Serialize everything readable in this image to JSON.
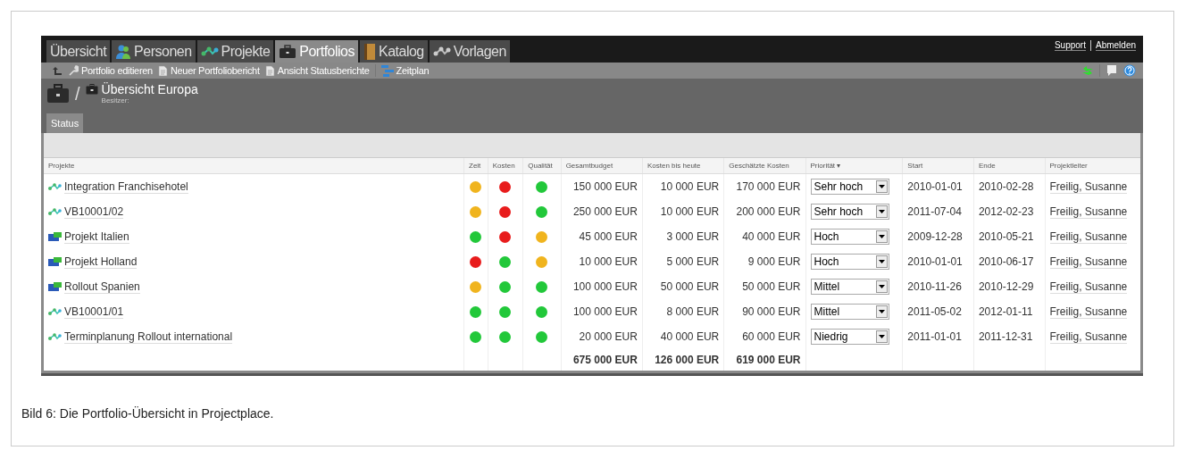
{
  "nav": {
    "tabs": [
      {
        "label": "Übersicht",
        "kind": "plain",
        "selected": false
      },
      {
        "label": "Personen",
        "kind": "people",
        "selected": false
      },
      {
        "label": "Projekte",
        "kind": "network",
        "selected": false
      },
      {
        "label": "Portfolios",
        "kind": "briefcase",
        "selected": true
      },
      {
        "label": "Katalog",
        "kind": "book",
        "selected": false
      },
      {
        "label": "Vorlagen",
        "kind": "greynetwork",
        "selected": false
      }
    ],
    "links": [
      "Support",
      "Abmelden"
    ]
  },
  "toolbar": {
    "items": [
      {
        "label": "Portfolio editieren",
        "kind": "wrench"
      },
      {
        "label": "Neuer Portfoliobericht",
        "kind": "document"
      },
      {
        "label": "Ansicht Statusberichte",
        "kind": "document"
      },
      {
        "label": "Zeitplan",
        "kind": "schedule"
      }
    ]
  },
  "header": {
    "separator": "/",
    "title": "Übersicht Europa",
    "subtitle": "Besitzer:"
  },
  "subtabs": [
    {
      "label": "Status",
      "selected": true
    }
  ],
  "table": {
    "columns": [
      "Projekte",
      "Zeit",
      "Kosten",
      "Qualität",
      "Gesamtbudget",
      "Kosten bis heute",
      "Geschätzte Kosten",
      "Priorität ▾",
      "Start",
      "Ende",
      "Projektleiter"
    ],
    "rows": [
      {
        "name": "Integration Franchisehotel",
        "kind": "project",
        "status": [
          {
            "color": "#f0b41e"
          },
          {
            "color": "#e81c1c"
          },
          {
            "color": "#22c83a"
          }
        ],
        "budget": "150 000 EUR",
        "bisheute": "10 000 EUR",
        "geschaetzt": "170 000 EUR",
        "prioritaet": "Sehr hoch",
        "start": "2010-01-01",
        "ende": "2010-02-28",
        "leiter": "Freilig, Susanne"
      },
      {
        "name": "VB10001/02",
        "kind": "project",
        "status": [
          {
            "color": "#f0b41e"
          },
          {
            "color": "#e81c1c"
          },
          {
            "color": "#22c83a"
          }
        ],
        "budget": "250 000 EUR",
        "bisheute": "10 000 EUR",
        "geschaetzt": "200 000 EUR",
        "prioritaet": "Sehr hoch",
        "start": "2011-07-04",
        "ende": "2012-02-23",
        "leiter": "Freilig, Susanne"
      },
      {
        "name": "Projekt Italien",
        "kind": "portfolio",
        "status": [
          {
            "color": "#22c83a"
          },
          {
            "color": "#e81c1c"
          },
          {
            "color": "#f0b41e"
          }
        ],
        "budget": "45 000 EUR",
        "bisheute": "3 000 EUR",
        "geschaetzt": "40 000 EUR",
        "prioritaet": "Hoch",
        "start": "2009-12-28",
        "ende": "2010-05-21",
        "leiter": "Freilig, Susanne"
      },
      {
        "name": "Projekt Holland",
        "kind": "portfolio",
        "status": [
          {
            "color": "#e81c1c"
          },
          {
            "color": "#22c83a"
          },
          {
            "color": "#f0b41e"
          }
        ],
        "budget": "10 000 EUR",
        "bisheute": "5 000 EUR",
        "geschaetzt": "9 000 EUR",
        "prioritaet": "Hoch",
        "start": "2010-01-01",
        "ende": "2010-06-17",
        "leiter": "Freilig, Susanne"
      },
      {
        "name": "Rollout Spanien",
        "kind": "portfolio",
        "status": [
          {
            "color": "#f0b41e"
          },
          {
            "color": "#22c83a"
          },
          {
            "color": "#22c83a"
          }
        ],
        "budget": "100 000 EUR",
        "bisheute": "50 000 EUR",
        "geschaetzt": "50 000 EUR",
        "prioritaet": "Mittel",
        "start": "2010-11-26",
        "ende": "2010-12-29",
        "leiter": "Freilig, Susanne"
      },
      {
        "name": "VB10001/01",
        "kind": "project",
        "status": [
          {
            "color": "#22c83a"
          },
          {
            "color": "#22c83a"
          },
          {
            "color": "#22c83a"
          }
        ],
        "budget": "100 000 EUR",
        "bisheute": "8 000 EUR",
        "geschaetzt": "90 000 EUR",
        "prioritaet": "Mittel",
        "start": "2011-05-02",
        "ende": "2012-01-11",
        "leiter": "Freilig, Susanne"
      },
      {
        "name": "Terminplanung Rollout international",
        "kind": "project",
        "status": [
          {
            "color": "#22c83a"
          },
          {
            "color": "#22c83a"
          },
          {
            "color": "#22c83a"
          }
        ],
        "budget": "20 000 EUR",
        "bisheute": "40 000 EUR",
        "geschaetzt": "60 000 EUR",
        "prioritaet": "Niedrig",
        "start": "2011-01-01",
        "ende": "2011-12-31",
        "leiter": "Freilig, Susanne"
      }
    ],
    "totals": {
      "budget": "675 000 EUR",
      "bisheute": "126 000 EUR",
      "geschaetzt": "619 000 EUR"
    }
  },
  "caption": "Bild 6: Die Portfolio-Übersicht in Projectplace."
}
